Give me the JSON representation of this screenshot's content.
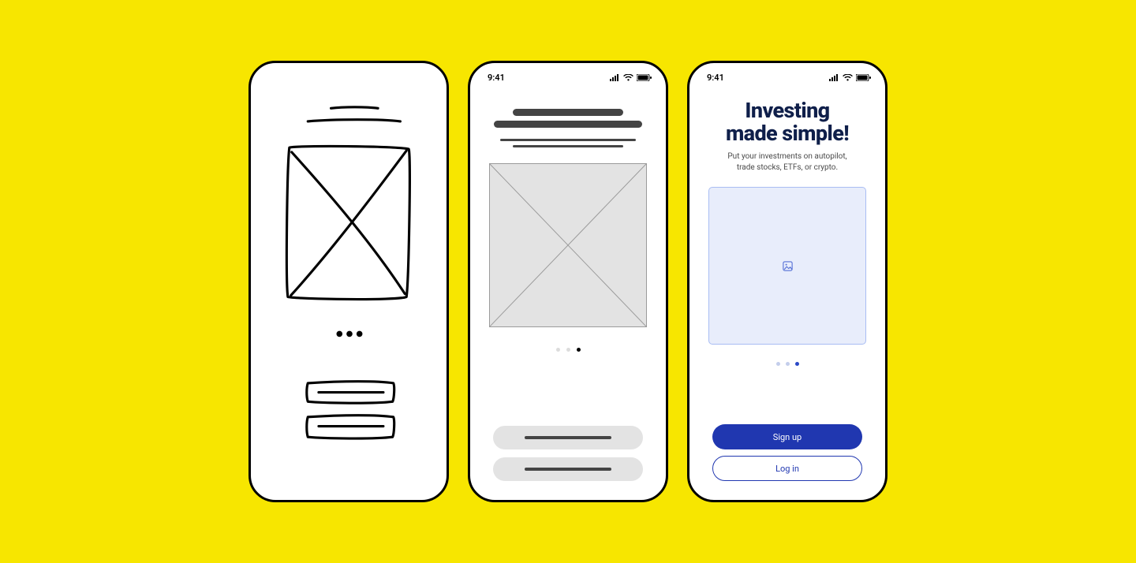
{
  "statusbar": {
    "time": "9:41"
  },
  "screen": {
    "headline_line1": "Investing",
    "headline_line2": "made simple!",
    "sub_line1": "Put your investments on autopilot,",
    "sub_line2": "trade stocks, ETFs, or crypto.",
    "primary_cta": "Sign up",
    "secondary_cta": "Log in"
  }
}
